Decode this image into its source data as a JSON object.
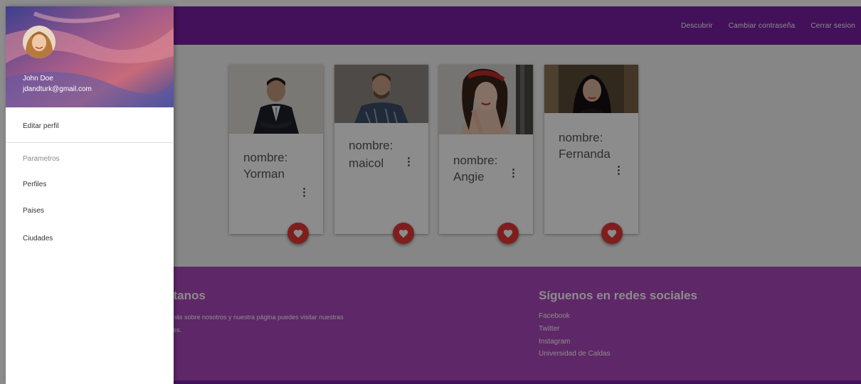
{
  "navbar": {
    "links": [
      "Descubrir",
      "Cambiar contraseña",
      "Cerrar sesion"
    ]
  },
  "cards": [
    {
      "label": "nombre:",
      "name": "Yorman"
    },
    {
      "label": "nombre:",
      "name": "maicol"
    },
    {
      "label": "nombre:",
      "name": "Angie"
    },
    {
      "label": "nombre:",
      "name": "Fernanda"
    }
  ],
  "footer": {
    "contact_title": "ctanos",
    "contact_text_line1": "r más sobre nosotros y nuestra página puedes visitar nuestras",
    "contact_text_line2": "iales.",
    "social_title": "Síguenos en redes sociales",
    "social_links": [
      "Facebook",
      "Twitter",
      "Instagram",
      "Universidad de Caldas"
    ]
  },
  "sidenav": {
    "user_name": "John Doe",
    "user_email": "jdandturk@gmail.com",
    "edit_profile": "Editar perfil",
    "section_label": "Parametros",
    "items": [
      "Perfiles",
      "Paises",
      "Ciudades"
    ]
  },
  "colors": {
    "primary": "#7b1fa2",
    "footer": "#ab47bc",
    "fab": "#e53935"
  }
}
